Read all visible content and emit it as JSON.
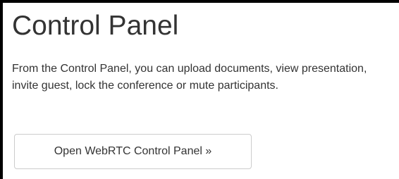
{
  "panel": {
    "title": "Control Panel",
    "description": "From the Control Panel, you can upload documents, view presentation, invite guest, lock the conference or mute participants.",
    "open_button_label": "Open WebRTC Control Panel »"
  }
}
